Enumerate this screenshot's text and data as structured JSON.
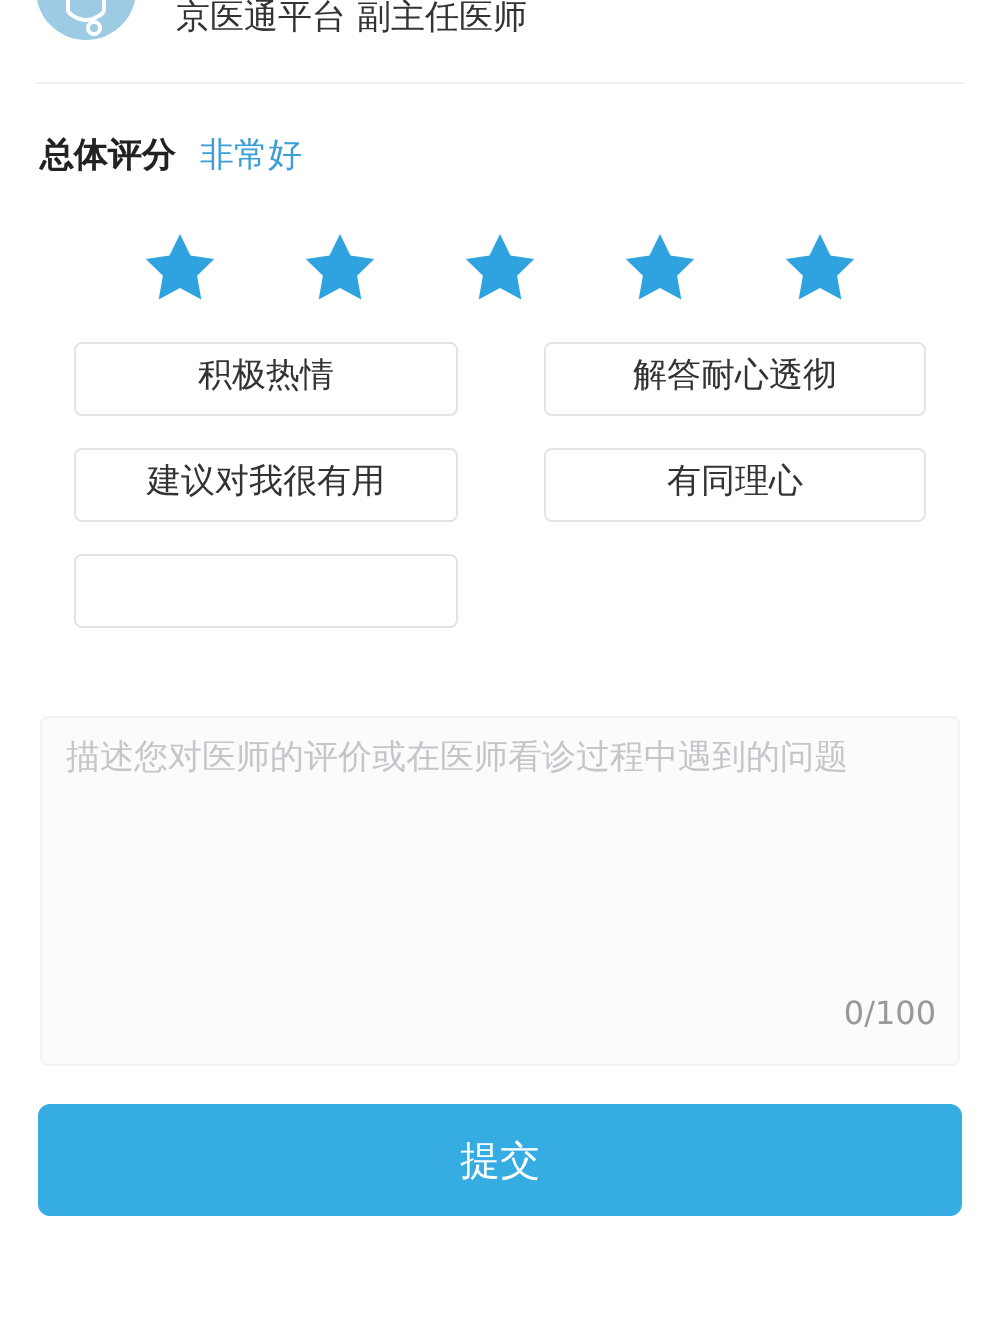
{
  "doctor": {
    "subtitle": "京医通平台 副主任医师"
  },
  "rating": {
    "label": "总体评分",
    "verdict": "非常好",
    "stars": 5
  },
  "tags": [
    {
      "kind": "tag",
      "label": "积极热情"
    },
    {
      "kind": "tag",
      "label": "解答耐心透彻"
    },
    {
      "kind": "tag",
      "label": "建议对我很有用"
    },
    {
      "kind": "tag",
      "label": "有同理心"
    },
    {
      "kind": "tag"
    }
  ],
  "comment": {
    "placeholder": "描述您对医师的评价或在医师看诊过程中遇到的问题",
    "counter": "0/100"
  },
  "submit": {
    "label": "提交"
  }
}
